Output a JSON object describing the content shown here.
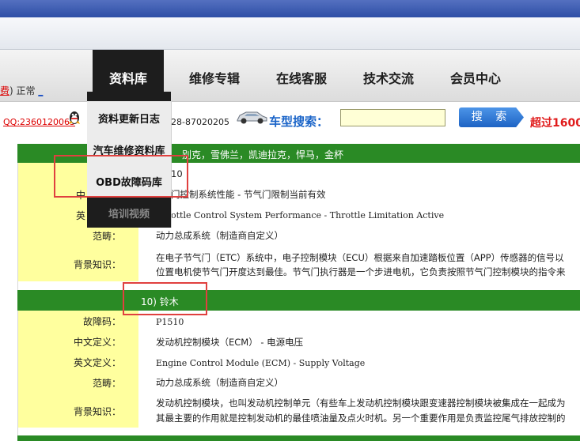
{
  "status": {
    "prefix": "费",
    "state": "正常"
  },
  "nav": {
    "items": [
      "资料库",
      "维修专辑",
      "在线客服",
      "技术交流",
      "会员中心"
    ]
  },
  "contact": {
    "qq": "QQ:2360120063",
    "phone": "28-87020205"
  },
  "search": {
    "label": "车型搜索：",
    "input_value": "",
    "button": "搜 索",
    "promo": "超过1600"
  },
  "dropdown": {
    "items": [
      "资料更新日志",
      "汽车维修资料库",
      "OBD故障码库",
      "培训视频"
    ]
  },
  "entry1": {
    "header": "别克，雪佛兰，凯迪拉克，悍马，金杯",
    "code_partial": "10",
    "cn_label_partial": "中",
    "cn_value": "门控制系统性能 - 节气门限制当前有效",
    "en_label_partial": "英",
    "en_value": "ottle Control System Performance - Throttle Limitation Active",
    "scope_label": "范畴：",
    "scope_value": "动力总成系统（制造商自定义）",
    "bg_label": "背景知识：",
    "bg_line1": "在电子节气门（ETC）系统中，电子控制模块（ECU）根据来自加速踏板位置（APP）传感器的信号以",
    "bg_line2": "位置电机使节气门开度达到最佳。节气门执行器是一个步进电机，它负责按照节气门控制模块的指令来"
  },
  "entry2": {
    "header": "10) 铃木",
    "code_label": "故障码：",
    "code_value": "P1510",
    "cn_label": "中文定义：",
    "cn_value": "发动机控制模块（ECM） - 电源电压",
    "en_label": "英文定义：",
    "en_value": "Engine Control Module (ECM) - Supply Voltage",
    "scope_label": "范畴：",
    "scope_value": "动力总成系统（制造商自定义）",
    "bg_label": "背景知识：",
    "bg_line1": "发动机控制模块，也叫发动机控制单元（有些车上发动机控制模块跟变速器控制模块被集成在一起成为",
    "bg_line2": "其最主要的作用就是控制发动机的最佳喷油量及点火时机。另一个重要作用是负责监控尾气排放控制的"
  },
  "colors": {
    "green_band": "#2a8a25",
    "yellow_col": "#ffff9e",
    "nav_active": "#1d1d1d",
    "highlight": "#e0403f",
    "search_blue": "#1a64c8"
  }
}
